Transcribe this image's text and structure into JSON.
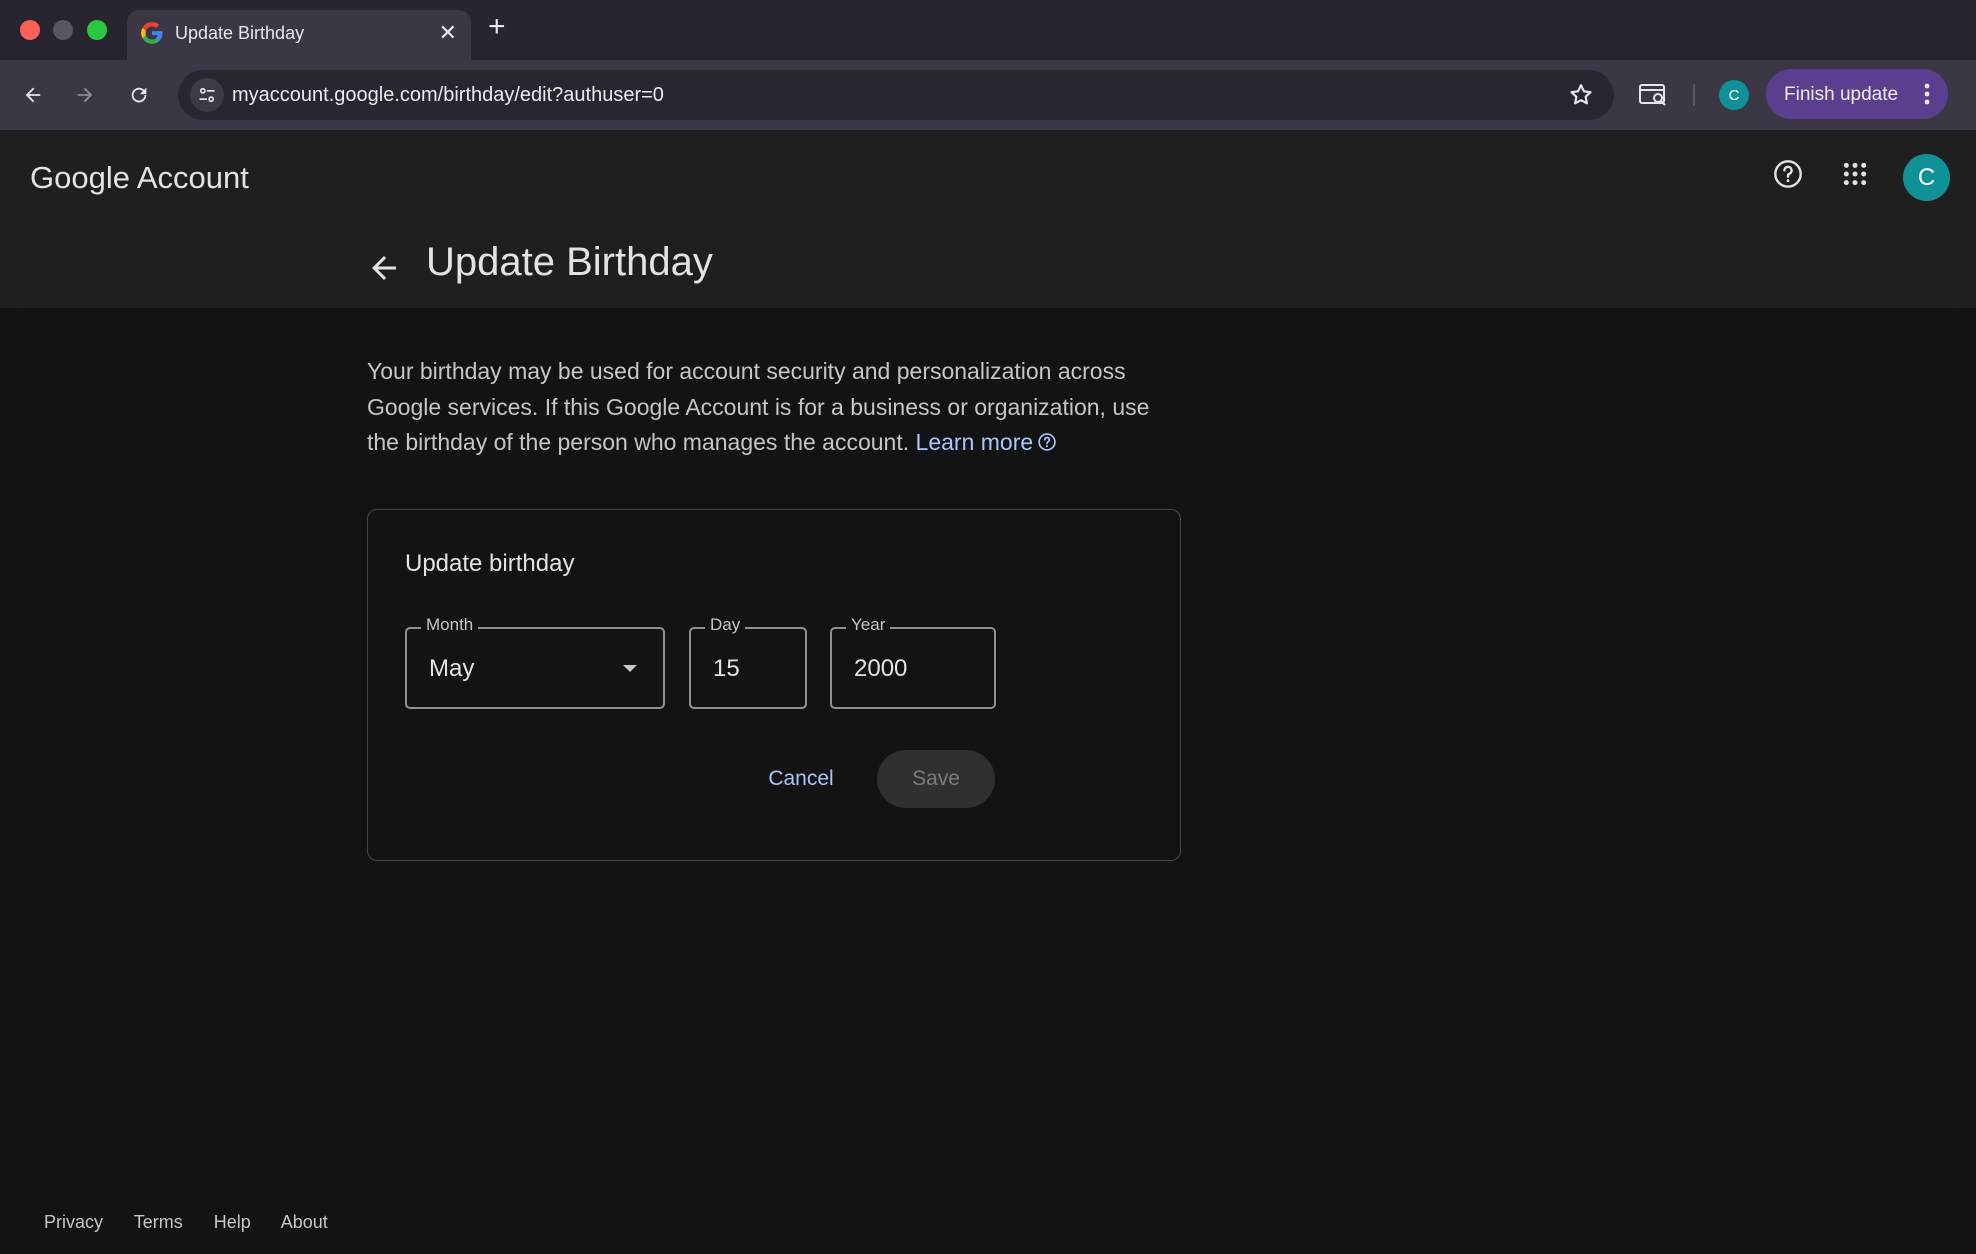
{
  "browser": {
    "tab_title": "Update Birthday",
    "tab_close": "✕",
    "new_tab": "+",
    "url": "myaccount.google.com/birthday/edit?authuser=0",
    "profile_initial": "C",
    "finish_update_label": "Finish update"
  },
  "header": {
    "logo_google": "Google",
    "logo_account": "Account",
    "avatar_initial": "C",
    "page_title": "Update Birthday"
  },
  "description": {
    "text": "Your birthday may be used for account security and personalization across Google services. If this Google Account is for a business or organization, use the birthday of the person who manages the account.",
    "learn_more": "Learn more"
  },
  "card": {
    "title": "Update birthday",
    "month_label": "Month",
    "month_value": "May",
    "day_label": "Day",
    "day_value": "15",
    "year_label": "Year",
    "year_value": "2000",
    "cancel_label": "Cancel",
    "save_label": "Save"
  },
  "footer": {
    "links": [
      "Privacy",
      "Terms",
      "Help",
      "About"
    ]
  },
  "colors": {
    "accent_link": "#a8c7fa",
    "avatar_bg": "#0e9297",
    "finish_btn_bg": "#5b3f8f"
  }
}
